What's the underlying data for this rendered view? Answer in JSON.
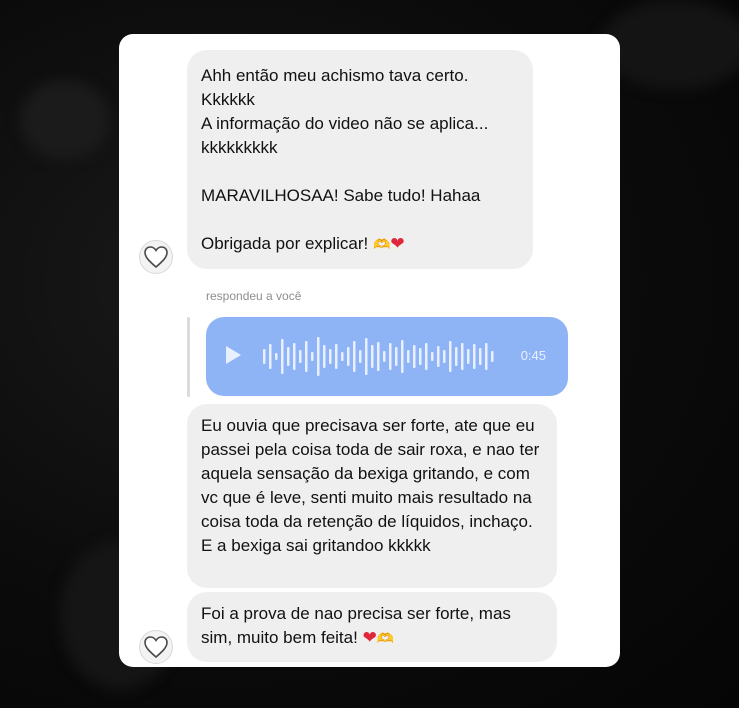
{
  "messages": [
    {
      "text": "Ahh então meu achismo tava certo.\nKkkkkk\nA informação do video não se aplica...\nkkkkkkkkk\n\nMARAVILHOSAA! Sabe tudo! Hahaa\n\nObrigada por explicar! ",
      "emoji_1": "🫶",
      "emoji_2": "❤"
    }
  ],
  "reply_label": "respondeu a você",
  "audio": {
    "duration": "0:45",
    "icon": "play-icon"
  },
  "message_2": "Eu ouvia que precisava ser forte, ate que eu passei pela coisa toda de sair roxa, e nao ter aquela sensação da bexiga gritando, e com vc que é leve, senti muito mais resultado na coisa toda da retenção de líquidos, inchaço. E a bexiga sai gritandoo kkkkk",
  "message_3": {
    "text": "Foi a prova de nao precisa ser forte, mas sim, muito bem feita! ",
    "emoji_1": "❤",
    "emoji_2": "🫶"
  },
  "colors": {
    "audio_bubble": "#8fb4f6",
    "received_bubble": "#efefef",
    "heart": "#e0263a"
  },
  "icons": [
    "heart-avatar-icon",
    "play-icon"
  ]
}
